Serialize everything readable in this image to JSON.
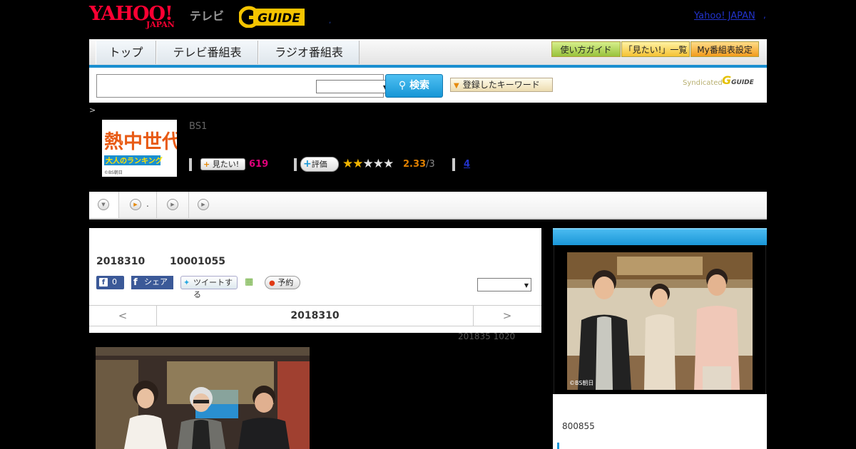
{
  "header": {
    "logo_yahoo": "YAHOO!",
    "logo_japan": "JAPAN",
    "logo_tv": "テレビ",
    "logo_gguide": "GUIDE",
    "dot": ",",
    "yahoo_link": "Yahoo! JAPAN",
    "yahoo_link_dot": ","
  },
  "nav": {
    "tabs": [
      "トップ",
      "テレビ番組表",
      "ラジオ番組表"
    ],
    "guide_button": "使い方ガイド",
    "mitai_list_button": "「見たい!」一覧",
    "my_schedule_button": "My番組表設定"
  },
  "search": {
    "button_label": "検索",
    "keyword_button": "登録したキーワード",
    "syndicated": "Syndicated",
    "syndicated_logo": "GUIDE"
  },
  "breadcrumb": ">",
  "program": {
    "logo_title": "熱中世代",
    "logo_subtitle": "大人のランキング",
    "logo_copyright": "©BS朝日",
    "channel": "BS1",
    "mitai_button": "見たい!",
    "mitai_count": "619",
    "hyouka_button": "評価",
    "rating": "2.33",
    "rating_max": "/3",
    "stars_on": 2,
    "review_count": "4"
  },
  "tabstrip": {
    "tab2_text": "."
  },
  "info": {
    "date": "2018310",
    "id": "10001055",
    "fb_like_count": "0",
    "fb_share": "シェア",
    "tweet": "ツイートする",
    "yoyaku": "予約",
    "date_nav_prev": "<",
    "date_nav_date": "2018310",
    "date_nav_next": ">"
  },
  "airtime": "201835  1020",
  "right": {
    "photo_copyright": "©BS朝日",
    "code": "800855"
  },
  "colors": {
    "accent_blue": "#1a8fd0",
    "yahoo_red": "#ff0033",
    "gguide_yellow": "#f5c400",
    "mitai_pink": "#e0007a",
    "rating_orange": "#e08000"
  }
}
